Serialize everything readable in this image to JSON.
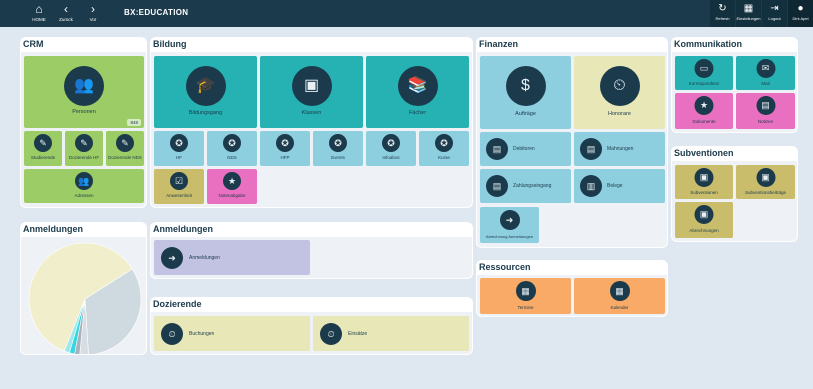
{
  "topbar": {
    "nav": [
      {
        "label": "HOME",
        "icon": "home-icon",
        "glyph": "⌂"
      },
      {
        "label": "Zurück",
        "icon": "back-icon",
        "glyph": "‹"
      },
      {
        "label": "Vor",
        "icon": "forward-icon",
        "glyph": "›"
      }
    ],
    "title": "BX:EDUCATION",
    "tools": [
      {
        "label": "Refresh",
        "icon": "refresh-icon",
        "glyph": "↻"
      },
      {
        "label": "Einstellungen",
        "icon": "settings-icon",
        "glyph": "▦"
      },
      {
        "label": "Logout",
        "icon": "logout-icon",
        "glyph": "⇥"
      },
      {
        "label": "Dirk Apel",
        "icon": "user-icon",
        "glyph": "●"
      }
    ]
  },
  "panels": {
    "crm": {
      "title": "CRM"
    },
    "bildung": {
      "title": "Bildung"
    },
    "finanzen": {
      "title": "Finanzen"
    },
    "kommunikation": {
      "title": "Kommunikation"
    },
    "subventionen": {
      "title": "Subventionen"
    },
    "anmeldungen_chart": {
      "title": "Anmeldungen"
    },
    "anmeldungen": {
      "title": "Anmeldungen"
    },
    "ressourcen": {
      "title": "Ressourcen"
    },
    "dozierende": {
      "title": "Dozierende"
    }
  },
  "crm": {
    "personen": "Personen",
    "badge": "848",
    "small": [
      "Studierende",
      "Dozierende HF",
      "Dozierende NDS"
    ],
    "adressen": "Adressen"
  },
  "bildung": {
    "big": [
      "Bildungsgang",
      "Klassen",
      "Fächer"
    ],
    "small": [
      "HF",
      "NDS",
      "HFP",
      "Events",
      "Infoabos",
      "Kurse"
    ],
    "extra": [
      "Anwesenheit",
      "Notenabgabe"
    ]
  },
  "finanzen": {
    "big": [
      "Aufträge",
      "Honorare"
    ],
    "rows": [
      "Debitoren",
      "Mahnungen",
      "Zahlungseingang",
      "Belege"
    ],
    "abrechnung": "Abrechnung Anmeldungen"
  },
  "kommunikation": {
    "items": [
      "Korrespondenz",
      "Mail",
      "Dokumente",
      "Notizen"
    ]
  },
  "subventionen": {
    "items": [
      "Subventionen",
      "Subventionsbeiträge",
      "Abrechnungen"
    ]
  },
  "anmeldungen": {
    "item": "Anmeldungen"
  },
  "ressourcen": {
    "items": [
      "Termine",
      "Kalender"
    ]
  },
  "dozierende": {
    "items": [
      "Buchungen",
      "Einsätze"
    ]
  },
  "chart_data": {
    "type": "pie",
    "values": [
      60,
      33,
      2.5,
      1.5,
      1.5,
      1.5
    ],
    "colors": [
      "#f1eecb",
      "#cfd9e0",
      "#d8dde3",
      "#a6b2bc",
      "#33d6e2",
      "#9fe7ee"
    ]
  }
}
